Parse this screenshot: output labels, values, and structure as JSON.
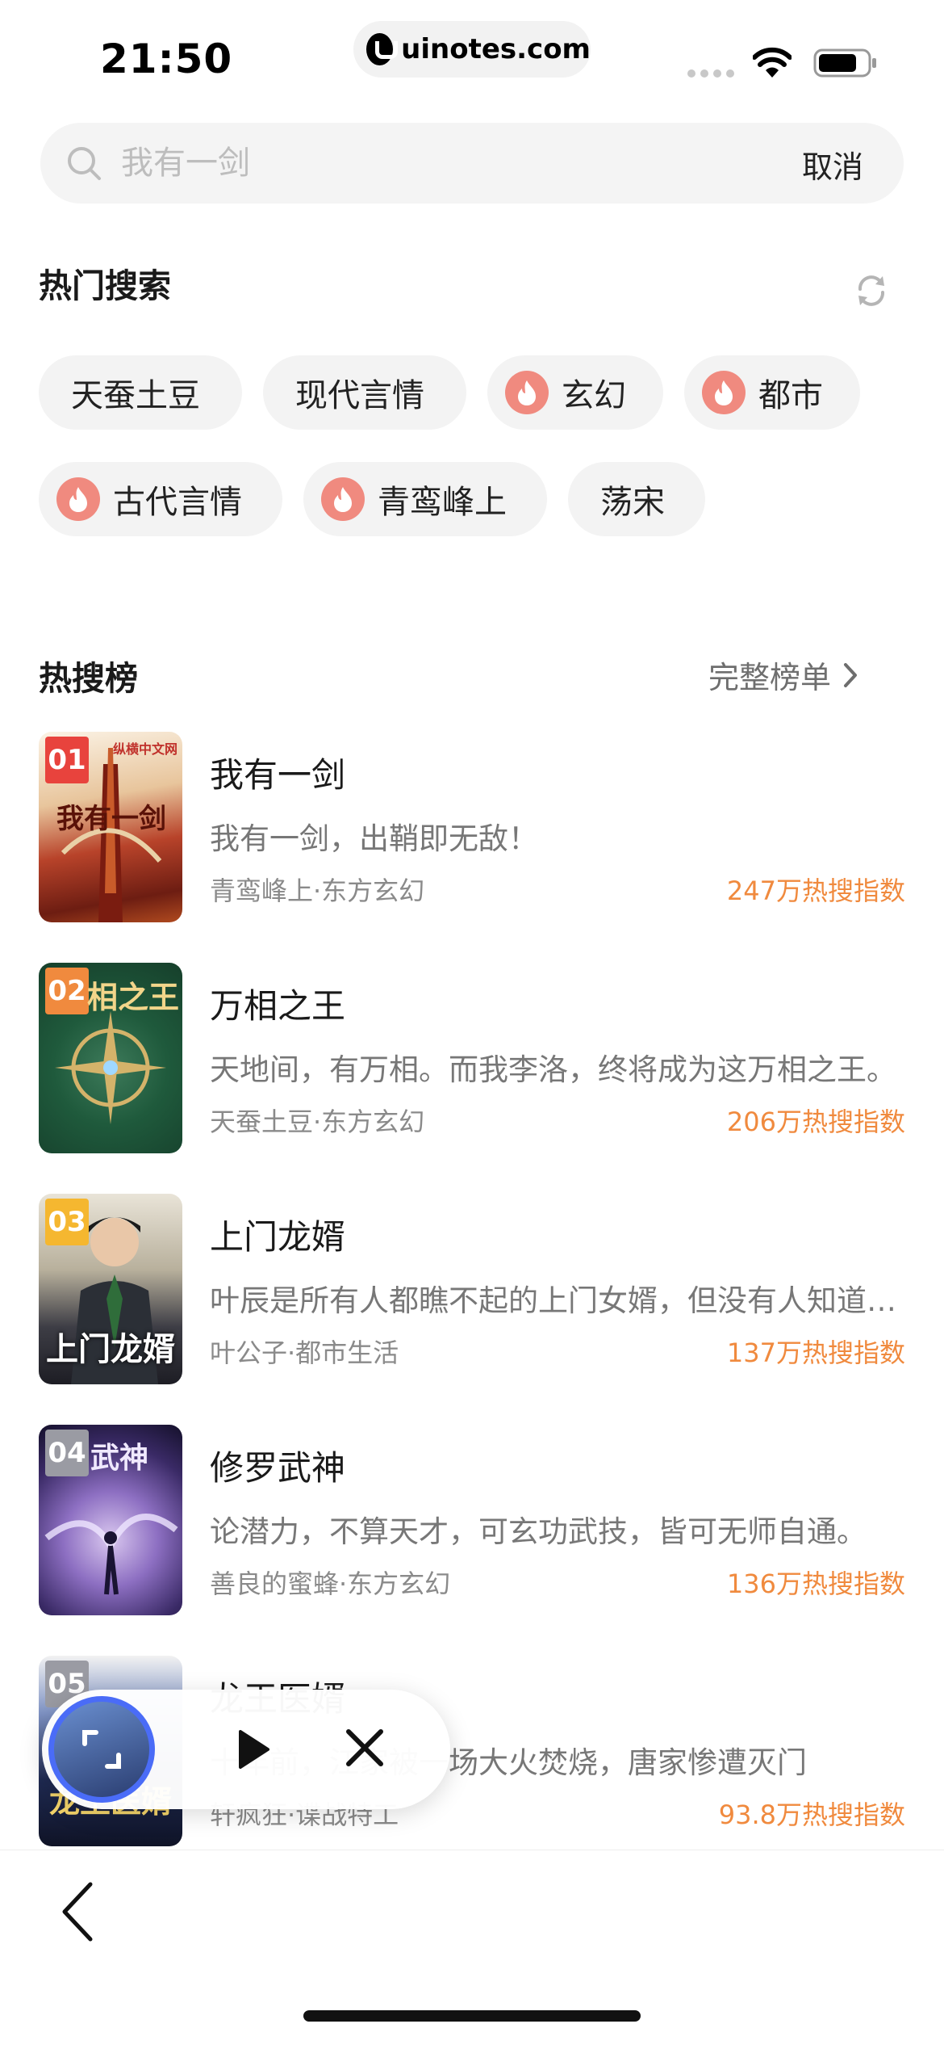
{
  "status_bar": {
    "time": "21:50",
    "url": "uinotes.com"
  },
  "search": {
    "placeholder": "我有一剑",
    "cancel_label": "取消"
  },
  "hot_search": {
    "title": "热门搜索",
    "chips": [
      {
        "label": "天蚕土豆",
        "fire": false
      },
      {
        "label": "现代言情",
        "fire": false
      },
      {
        "label": "玄幻",
        "fire": true
      },
      {
        "label": "都市",
        "fire": true
      },
      {
        "label": "古代言情",
        "fire": true
      },
      {
        "label": "青鸾峰上",
        "fire": true
      },
      {
        "label": "荡宋",
        "fire": false
      }
    ]
  },
  "hot_list": {
    "title": "热搜榜",
    "full_list_label": "完整榜单",
    "items": [
      {
        "rank": "01",
        "title": "我有一剑",
        "desc": "我有一剑，出鞘即无敌！",
        "meta": "青鸾峰上·东方玄幻",
        "heat": "247万热搜指数"
      },
      {
        "rank": "02",
        "title": "万相之王",
        "desc": "天地间，有万相。而我李洛，终将成为这万相之王。",
        "meta": "天蚕土豆·东方玄幻",
        "heat": "206万热搜指数"
      },
      {
        "rank": "03",
        "title": "上门龙婿",
        "desc": "叶辰是所有人都瞧不起的上门女婿，但没有人知道他的真实身份",
        "meta": "叶公子·都市生活",
        "heat": "137万热搜指数"
      },
      {
        "rank": "04",
        "title": "修罗武神",
        "desc": "论潜力，不算天才，可玄功武技，皆可无师自通。",
        "meta": "善良的蜜蜂·东方玄幻",
        "heat": "136万热搜指数"
      },
      {
        "rank": "05",
        "title": "龙王医婿",
        "desc": "十年前，江家被一场大火焚烧，唐家惨遭灭门",
        "meta": "轩疯狂·谍战特工",
        "heat": "93.8万热搜指数"
      }
    ]
  },
  "cover_text": {
    "publisher": "纵横中文网",
    "book1": "我有一剑",
    "book2": "相之王",
    "book3": "上门龙婿",
    "book4": "武神",
    "book5": "龙王医婿"
  }
}
